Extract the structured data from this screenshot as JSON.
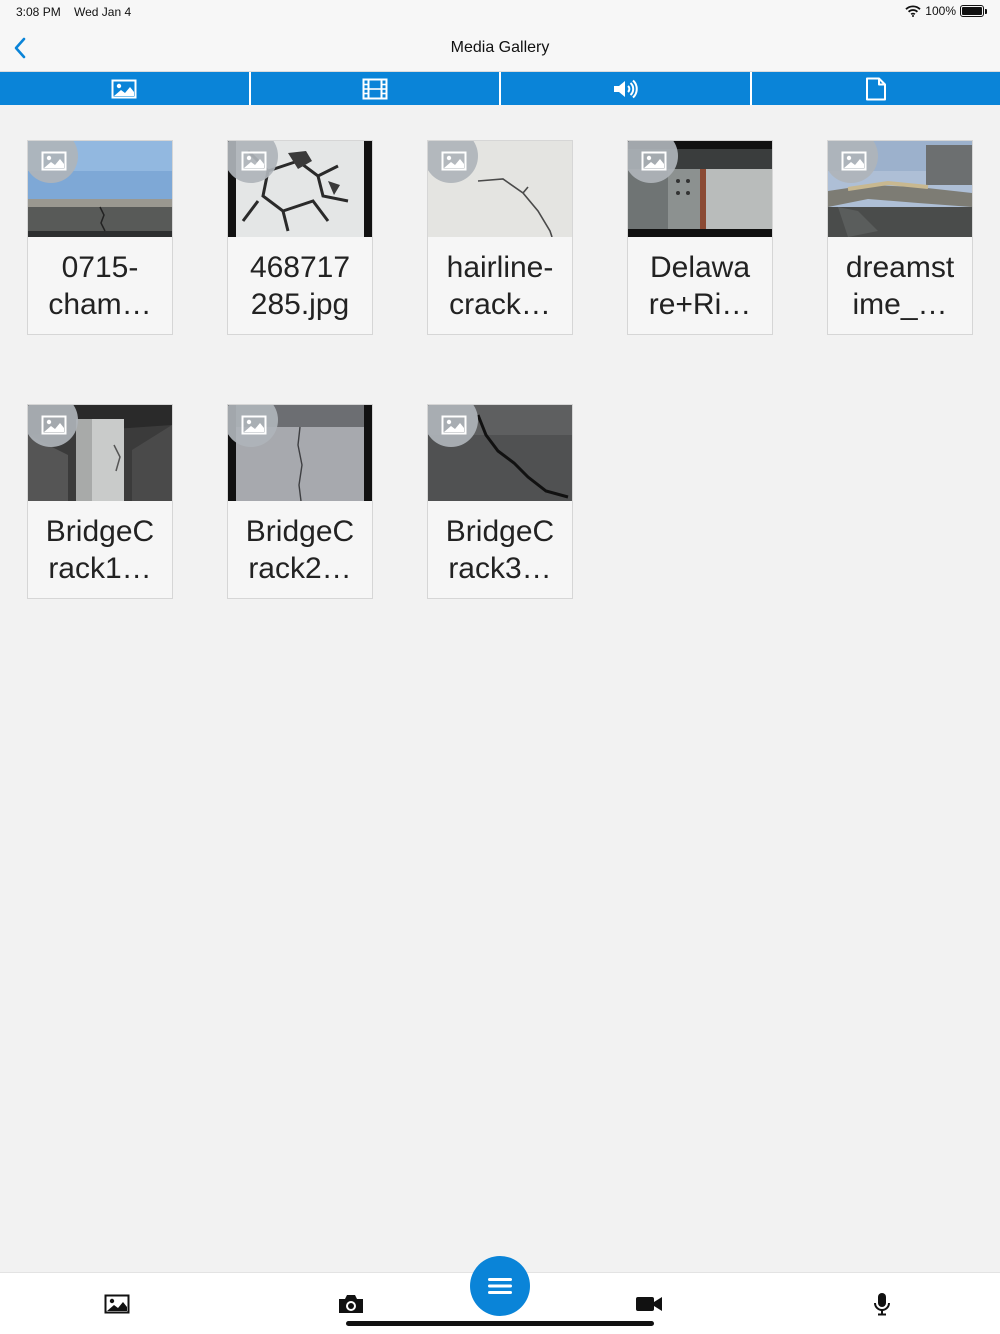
{
  "status": {
    "time": "3:08 PM",
    "date": "Wed Jan 4",
    "battery": "100%"
  },
  "nav": {
    "title": "Media Gallery",
    "back_icon": "chevron-left-icon"
  },
  "tabs": [
    {
      "icon": "image-icon"
    },
    {
      "icon": "film-icon"
    },
    {
      "icon": "speaker-icon"
    },
    {
      "icon": "document-icon"
    }
  ],
  "media": [
    {
      "line1": "0715-",
      "line2": "cham…",
      "scene": "bridge-sky"
    },
    {
      "line1": "468717",
      "line2": "285.jpg",
      "scene": "cracked-plaster"
    },
    {
      "line1": "hairline-",
      "line2": "crack…",
      "scene": "hairline-wall"
    },
    {
      "line1": "Delawa",
      "line2": "re+Ri…",
      "scene": "steel-girder"
    },
    {
      "line1": "dreamst",
      "line2": "ime_…",
      "scene": "collapsed-bridge"
    },
    {
      "line1": "BridgeC",
      "line2": "rack1…",
      "scene": "concrete-pier"
    },
    {
      "line1": "BridgeC",
      "line2": "rack2…",
      "scene": "concrete-wall"
    },
    {
      "line1": "BridgeC",
      "line2": "rack3…",
      "scene": "asphalt-crack"
    }
  ],
  "bottom_bar": [
    {
      "icon": "gallery-icon"
    },
    {
      "icon": "camera-icon"
    },
    {
      "icon": "menu-icon"
    },
    {
      "icon": "video-camera-icon"
    },
    {
      "icon": "microphone-icon"
    }
  ],
  "colors": {
    "accent": "#0a84d8",
    "background": "#f2f2f2"
  }
}
